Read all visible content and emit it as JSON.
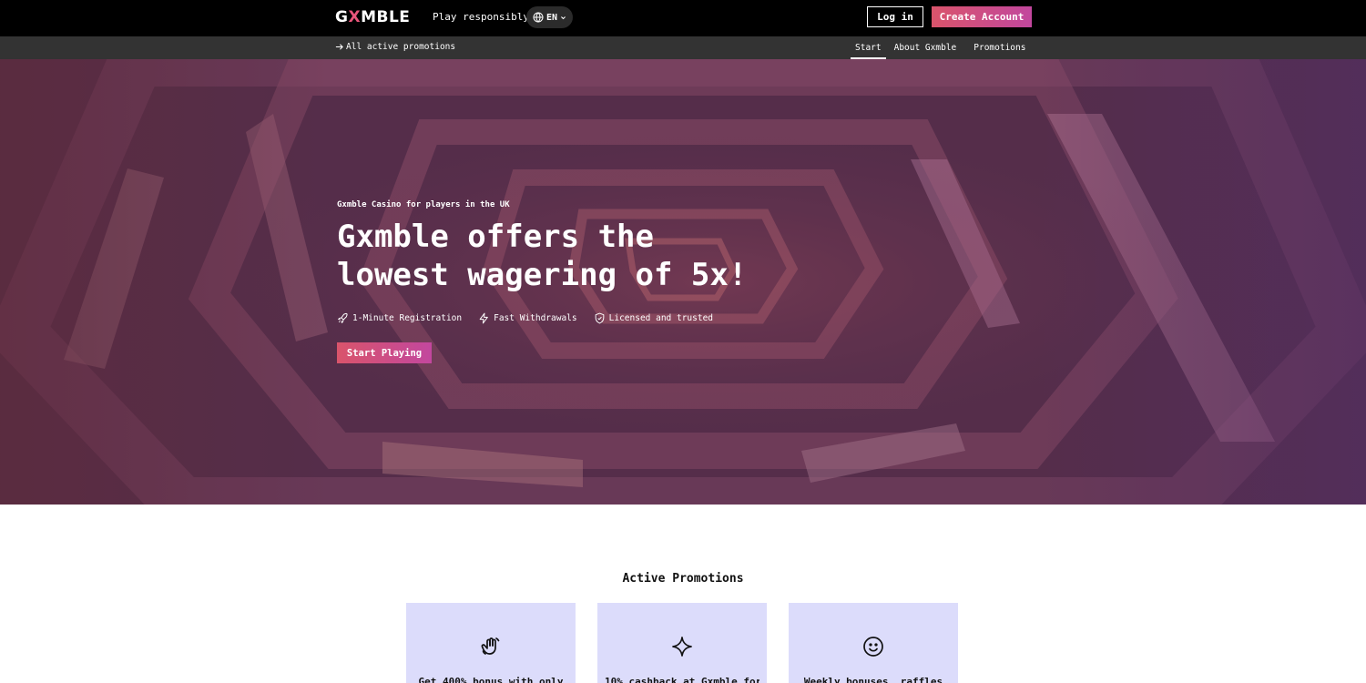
{
  "header": {
    "logo_prefix": "G",
    "logo_x": "X",
    "logo_suffix": "MBLE",
    "play_responsibly": "Play responsibly",
    "language": "EN",
    "login_label": "Log in",
    "create_account_label": "Create Account"
  },
  "subnav": {
    "promotions_link": "All active promotions",
    "links": [
      "Start",
      "About Gxmble",
      "Promotions"
    ],
    "active": "Start"
  },
  "hero": {
    "subtitle": "Gxmble Casino for players in the UK",
    "title_line1": "Gxmble offers the",
    "title_line2": "lowest wagering of 5x!",
    "features": [
      {
        "label": "1-Minute Registration",
        "icon": "rocket-icon"
      },
      {
        "label": "Fast Withdrawals",
        "icon": "lightning-icon"
      },
      {
        "label": "Licensed and trusted",
        "icon": "shield-check-icon"
      }
    ],
    "cta_label": "Start Playing"
  },
  "promotions": {
    "title": "Active Promotions",
    "cards": [
      {
        "icon": "waving-hand-icon",
        "text": "Get 400% bonus with only"
      },
      {
        "icon": "sparkle-icon",
        "text": "10% cashback at Gxmble for"
      },
      {
        "icon": "smiley-icon",
        "text": "Weekly bonuses, raffles"
      }
    ]
  },
  "colors": {
    "accent_start": "#d9546b",
    "accent_end": "#c2479e",
    "card_bg": "#dcdcfb",
    "topbar_bg": "#000000",
    "subnav_bg": "#333333"
  }
}
